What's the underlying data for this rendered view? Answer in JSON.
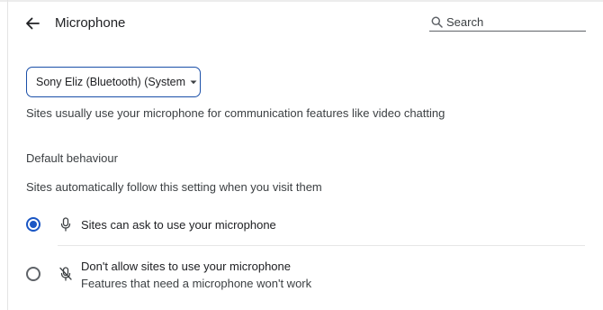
{
  "header": {
    "title": "Microphone",
    "search_placeholder": "Search"
  },
  "device_select": {
    "selected": "Sony Eliz (Bluetooth) (System"
  },
  "description": "Sites usually use your microphone for communication features like video chatting",
  "default_behaviour": {
    "heading": "Default behaviour",
    "subtext": "Sites automatically follow this setting when you visit them",
    "options": [
      {
        "label": "Sites can ask to use your microphone",
        "sublabel": "",
        "selected": true,
        "icon": "microphone-icon"
      },
      {
        "label": "Don't allow sites to use your microphone",
        "sublabel": "Features that need a microphone won't work",
        "selected": false,
        "icon": "microphone-off-icon"
      }
    ]
  },
  "colors": {
    "accent": "#1a56c4",
    "text": "#202124",
    "secondary_text": "#3c4043"
  }
}
